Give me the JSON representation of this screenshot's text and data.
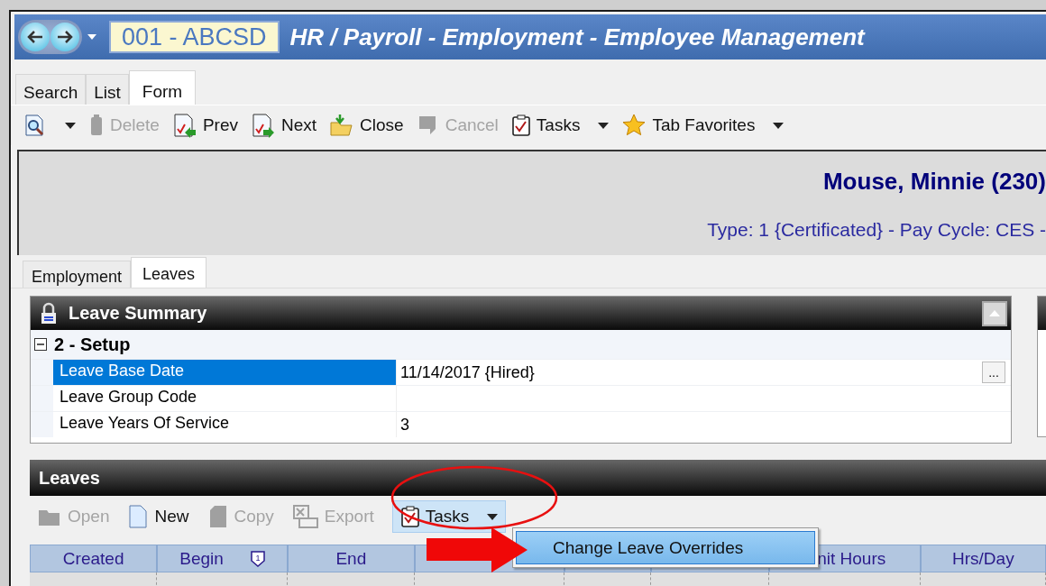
{
  "window": {
    "company": "001 - ABCSD",
    "title": "HR / Payroll - Employment - Employee Management"
  },
  "tabs": [
    {
      "label": "Search",
      "selected": false
    },
    {
      "label": "List",
      "selected": false
    },
    {
      "label": "Form",
      "selected": true
    }
  ],
  "toolbar": [
    {
      "kind": "search",
      "dropdown": true,
      "disabled": false
    },
    {
      "kind": "delete",
      "label": "Delete",
      "dropdown": false,
      "disabled": true
    },
    {
      "kind": "prev",
      "label": "Prev",
      "dropdown": false,
      "disabled": false
    },
    {
      "kind": "next",
      "label": "Next",
      "dropdown": false,
      "disabled": false
    },
    {
      "kind": "close",
      "label": "Close",
      "dropdown": false,
      "disabled": false
    },
    {
      "kind": "cancel",
      "label": "Cancel",
      "dropdown": false,
      "disabled": true
    },
    {
      "kind": "tasks",
      "label": "Tasks",
      "dropdown": true,
      "disabled": false
    },
    {
      "kind": "favorites",
      "label": "Tab Favorites",
      "dropdown": true,
      "disabled": false
    }
  ],
  "employee": {
    "name": "Mouse, Minnie (230)",
    "details": "Type: 1 {Certificated} - Pay Cycle: CES -"
  },
  "inner_tabs": [
    {
      "label": "Employment",
      "selected": false
    },
    {
      "label": "Leaves",
      "selected": true
    }
  ],
  "leave_summary": {
    "title": "Leave Summary",
    "group": {
      "label": "2 - Setup",
      "expanded": true
    },
    "rows": [
      {
        "label": "Leave Base Date",
        "value": "11/14/2017 {Hired}",
        "selected": true,
        "browse_button": "..."
      },
      {
        "label": "Leave Group Code",
        "value": "",
        "selected": false
      },
      {
        "label": "Leave Years Of Service",
        "value": "3",
        "selected": false
      }
    ]
  },
  "leaves": {
    "title": "Leaves",
    "toolbar": [
      {
        "kind": "open",
        "label": "Open",
        "disabled": true,
        "pressed": false,
        "dropdown": false
      },
      {
        "kind": "new",
        "label": "New",
        "disabled": false,
        "pressed": false,
        "dropdown": false
      },
      {
        "kind": "copy",
        "label": "Copy",
        "disabled": true,
        "pressed": false,
        "dropdown": false
      },
      {
        "kind": "export",
        "label": "Export",
        "disabled": true,
        "pressed": false,
        "dropdown": false
      },
      {
        "kind": "tasks",
        "label": "Tasks",
        "disabled": false,
        "pressed": true,
        "dropdown": true
      }
    ],
    "columns": [
      {
        "label": "Created"
      },
      {
        "label": "Begin",
        "sort_badge": "1"
      },
      {
        "label": "End"
      },
      {
        "label": "nit Hours"
      },
      {
        "label": "Hrs/Day"
      }
    ],
    "menu": [
      {
        "label": "Change Leave Overrides",
        "selected": true
      }
    ]
  }
}
